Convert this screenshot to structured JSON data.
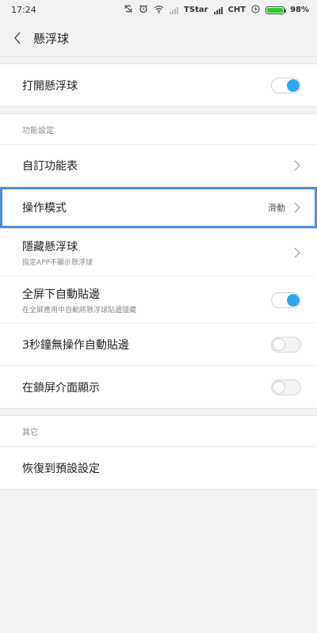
{
  "status_bar": {
    "time": "17:24",
    "carrier1": "TStar",
    "carrier2": "CHT",
    "battery": "98%",
    "battery_level": 0.98,
    "icons": [
      "sync-off-icon",
      "alarm-icon",
      "wifi-icon",
      "signal-icon",
      "signal-icon",
      "charging-icon",
      "battery-icon"
    ]
  },
  "header": {
    "title": "懸浮球"
  },
  "main_toggle": {
    "label": "打開懸浮球",
    "on": true
  },
  "features": {
    "header": "功能設定",
    "custom": {
      "label": "自訂功能表"
    },
    "mode": {
      "label": "操作模式",
      "value": "滑動"
    },
    "hide": {
      "label": "隱藏懸浮球",
      "sublabel": "指定APP不顯示懸浮球"
    },
    "fullscreen": {
      "label": "全屏下自動貼邊",
      "sublabel": "在全屏應用中自動將懸浮球貼邊隱藏",
      "on": true
    },
    "idle": {
      "label": "3秒鐘無操作自動貼邊",
      "on": false
    },
    "lockscreen": {
      "label": "在鎖屏介面顯示",
      "on": false
    }
  },
  "other": {
    "header": "其它",
    "reset": {
      "label": "恢復到預設設定"
    }
  },
  "colors": {
    "accent": "#33a7ee",
    "highlight": "#4a90d9",
    "battery": "#2ecc2e"
  }
}
